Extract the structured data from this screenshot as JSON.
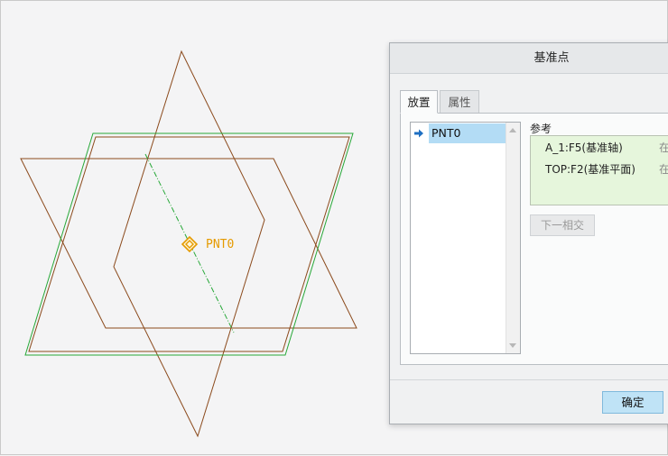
{
  "graphics": {
    "point_label": "PNT0",
    "colors": {
      "plane_edge": "#8b4a1c",
      "highlight": "#27a838",
      "point": "#e59a00"
    },
    "icons": [
      "datum-point-icon"
    ]
  },
  "dialog": {
    "title": "基准点",
    "tabs": [
      {
        "label": "放置",
        "active": true
      },
      {
        "label": "属性",
        "active": false
      }
    ],
    "points_list": [
      {
        "label": "PNT0",
        "selected": true,
        "icon": "arrow-right-icon"
      }
    ],
    "references": {
      "label": "参考",
      "items": [
        {
          "name": "A_1:F5(基准轴)",
          "type": "在"
        },
        {
          "name": "TOP:F2(基准平面)",
          "type": "在"
        }
      ]
    },
    "next_intersection_label": "下一相交",
    "ok_label": "确定",
    "colors": {
      "reference_bg": "#e6f6dc",
      "selected_item_bg": "#b3dcf5",
      "ok_button_bg": "#bfe3f6"
    }
  }
}
